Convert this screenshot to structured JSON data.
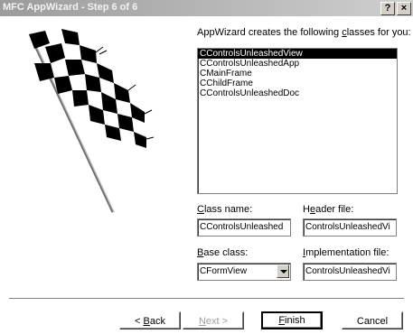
{
  "window": {
    "title": "MFC AppWizard - Step 6 of 6",
    "help_label": "?",
    "close_label": "×"
  },
  "prompt": {
    "before": "AppWizard creates the following ",
    "underlined": "c",
    "after": "lasses for you:"
  },
  "classes": [
    "CControlsUnleashedView",
    "CControlsUnleashedApp",
    "CMainFrame",
    "CChildFrame",
    "CControlsUnleashedDoc"
  ],
  "class_name": {
    "label_under": "C",
    "label_rest": "lass name:",
    "value": "CControlsUnleashed"
  },
  "header_file": {
    "label_pre": "H",
    "label_under": "e",
    "label_rest": "ader file:",
    "value": "ControlsUnleashedVi"
  },
  "base_class": {
    "label_under": "B",
    "label_rest": "ase class:",
    "value": "CFormView"
  },
  "impl_file": {
    "label_under": "I",
    "label_rest": "mplementation file:",
    "value": "ControlsUnleashedVi"
  },
  "buttons": {
    "back_pre": "< ",
    "back_under": "B",
    "back_rest": "ack",
    "next_under": "N",
    "next_rest": "ext >",
    "finish_under": "F",
    "finish_rest": "inish",
    "cancel": "Cancel"
  }
}
